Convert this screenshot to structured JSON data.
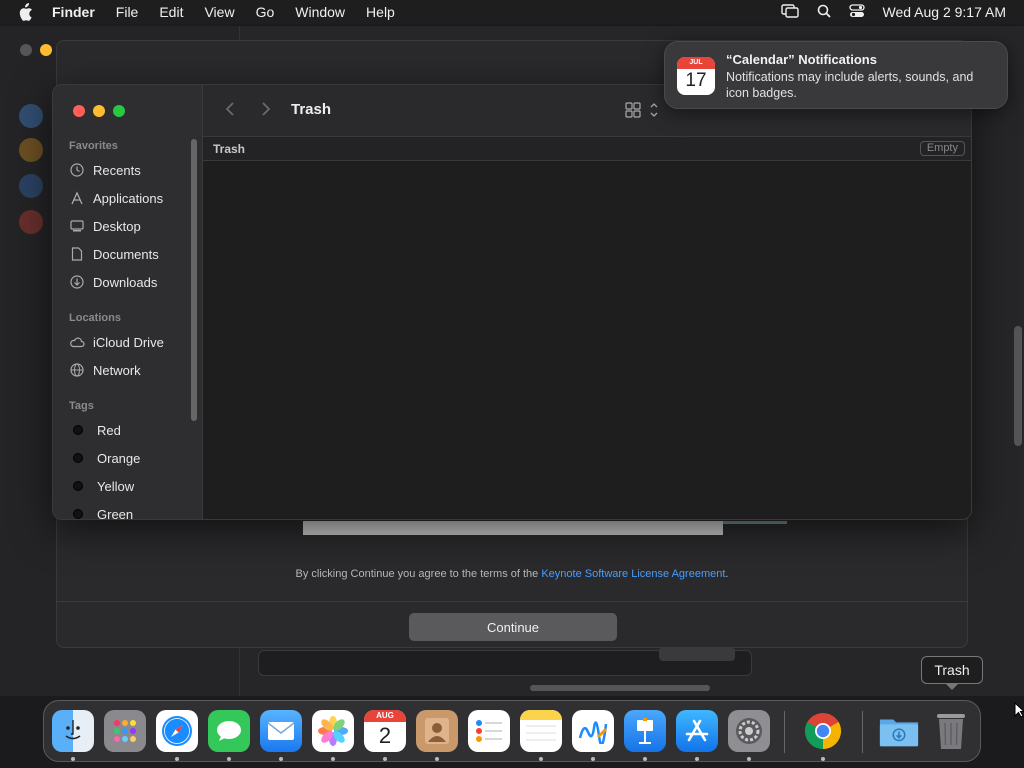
{
  "menubar": {
    "app_name": "Finder",
    "menus": [
      "File",
      "Edit",
      "View",
      "Go",
      "Window",
      "Help"
    ],
    "datetime": "Wed Aug 2  9:17 AM",
    "icons": [
      "apple-logo-icon",
      "screen-mirroring-icon",
      "spotlight-search-icon",
      "control-center-icon"
    ]
  },
  "finder": {
    "title": "Trash",
    "path_title": "Trash",
    "empty_button": "Empty",
    "sidebar": {
      "favorites_title": "Favorites",
      "favorites": [
        {
          "label": "Recents",
          "icon": "clock-icon"
        },
        {
          "label": "Applications",
          "icon": "applications-icon"
        },
        {
          "label": "Desktop",
          "icon": "desktop-icon"
        },
        {
          "label": "Documents",
          "icon": "document-icon"
        },
        {
          "label": "Downloads",
          "icon": "download-icon"
        }
      ],
      "locations_title": "Locations",
      "locations": [
        {
          "label": "iCloud Drive",
          "icon": "cloud-icon"
        },
        {
          "label": "Network",
          "icon": "network-icon"
        }
      ],
      "tags_title": "Tags",
      "tags": [
        {
          "label": "Red"
        },
        {
          "label": "Orange"
        },
        {
          "label": "Yellow"
        },
        {
          "label": "Green"
        }
      ]
    }
  },
  "installer": {
    "license_prefix": "By clicking Continue you agree to the terms of the ",
    "license_link": "Keynote Software License Agreement",
    "license_suffix": ".",
    "continue_label": "Continue"
  },
  "notification": {
    "calendar_month": "JUL",
    "calendar_day": "17",
    "title": "“Calendar” Notifications",
    "body": "Notifications may include alerts, sounds, and icon badges."
  },
  "dock": {
    "apps": [
      "Finder",
      "Launchpad",
      "Safari",
      "Messages",
      "Mail",
      "Photos",
      "Calendar",
      "Contacts",
      "Reminders",
      "Notes",
      "Freeform",
      "Keynote",
      "App Store",
      "System Settings",
      "Google Chrome",
      "Downloads",
      "Trash"
    ],
    "calendar_month": "AUG",
    "calendar_day": "2",
    "tooltip": "Trash"
  },
  "colors": {
    "accent": "#4a9eff",
    "close": "#ff5f57",
    "minimize": "#febc2e",
    "zoom": "#28c840"
  }
}
